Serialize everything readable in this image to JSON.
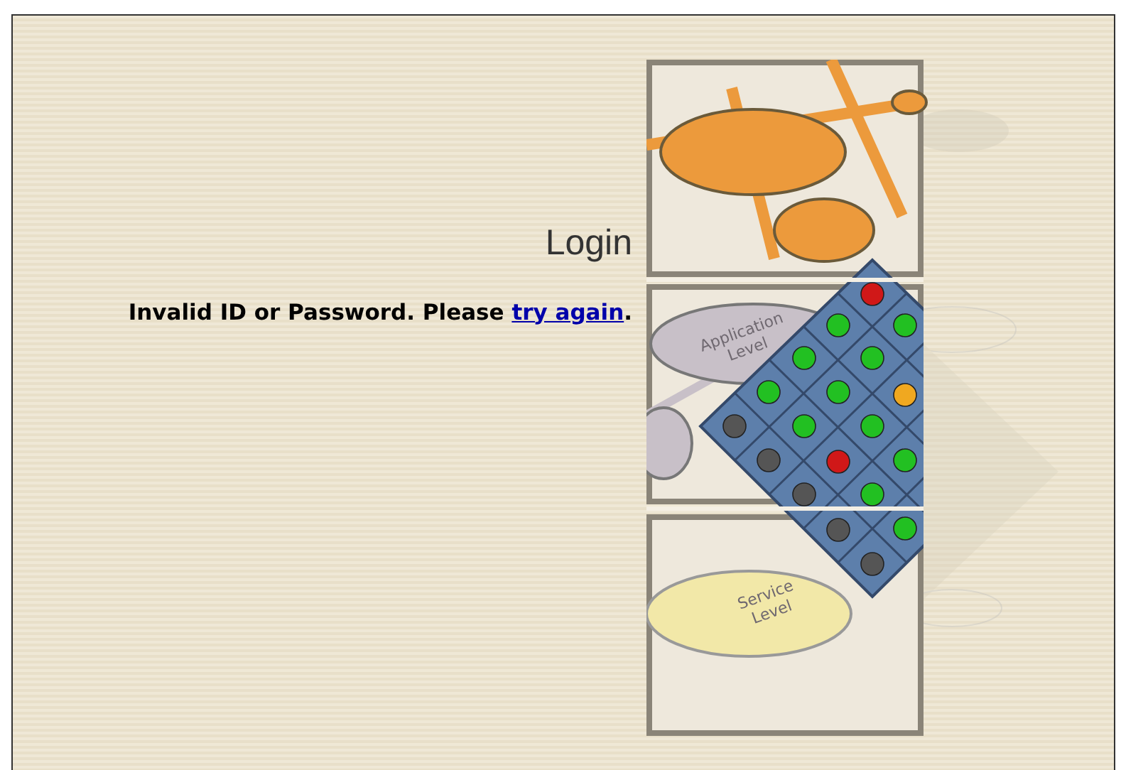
{
  "title": "Login",
  "message": {
    "text": "Invalid ID or Password. Please ",
    "link": "try again",
    "end": "."
  },
  "artwork": {
    "labels": [
      [
        "Application",
        "Level"
      ],
      [
        "Service",
        "Level"
      ]
    ]
  }
}
